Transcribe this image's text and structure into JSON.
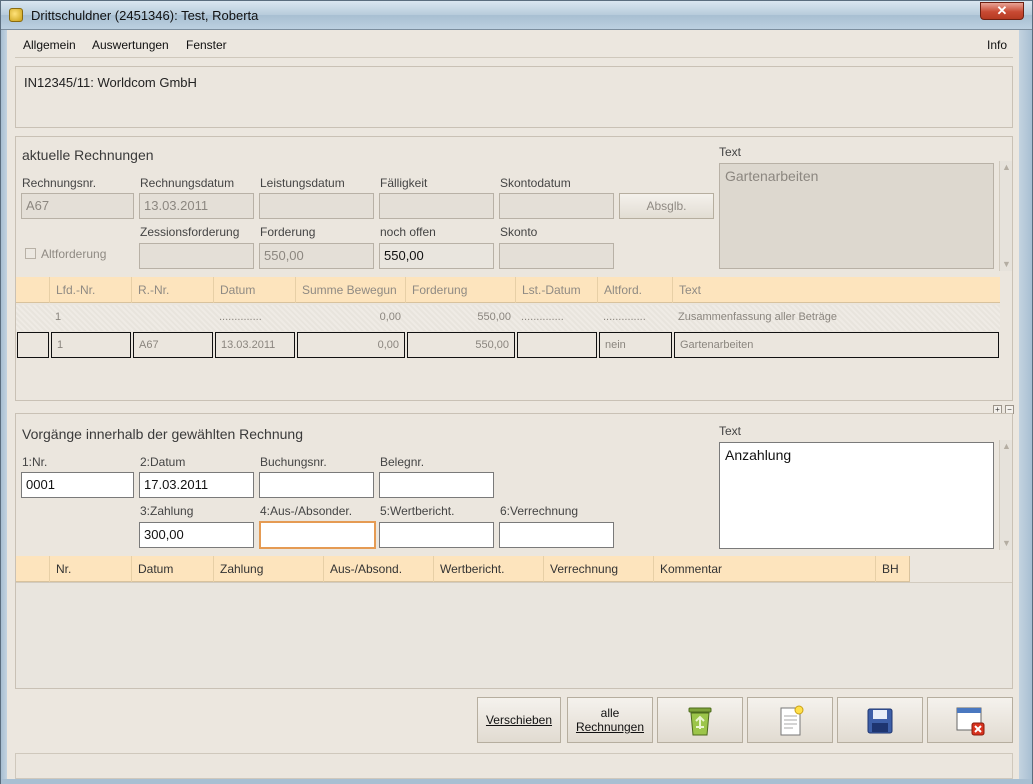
{
  "window": {
    "title": "Drittschuldner (2451346): Test, Roberta",
    "close_label": "✕"
  },
  "menu": {
    "items": [
      "Allgemein",
      "Auswertungen",
      "Fenster"
    ],
    "info": "Info"
  },
  "info_text": "IN12345/11: Worldcom GmbH",
  "rechnungen": {
    "title": "aktuelle Rechnungen",
    "labels": {
      "rechnungsnr": "Rechnungsnr.",
      "rechnungsdatum": "Rechnungsdatum",
      "leistungsdatum": "Leistungsdatum",
      "faelligkeit": "Fälligkeit",
      "skontodatum": "Skontodatum",
      "altforderung": "Altforderung",
      "zessionsforderung": "Zessionsforderung",
      "forderung": "Forderung",
      "noch_offen": "noch offen",
      "skonto": "Skonto",
      "text": "Text"
    },
    "values": {
      "rechnungsnr": "A67",
      "rechnungsdatum": "13.03.2011",
      "leistungsdatum": "",
      "faelligkeit": "",
      "skontodatum": "",
      "zessionsforderung": "",
      "forderung": "550,00",
      "noch_offen": "550,00",
      "skonto": "",
      "text": "Gartenarbeiten"
    },
    "absglb_button": "Absglb.",
    "table": {
      "columns": [
        "",
        "Lfd.-Nr.",
        "R.-Nr.",
        "Datum",
        "Summe Bewegun",
        "Forderung",
        "Lst.-Datum",
        "Altford.",
        "Text"
      ],
      "rows": [
        [
          "",
          "1",
          "",
          "..............",
          "0,00",
          "550,00",
          "..............",
          "..............",
          "Zusammenfassung aller Beträge"
        ],
        [
          "",
          "1",
          "A67",
          "13.03.2011",
          "0,00",
          "550,00",
          "",
          "nein",
          "Gartenarbeiten"
        ]
      ]
    }
  },
  "vorgaenge": {
    "title": "Vorgänge innerhalb der gewählten Rechnung",
    "labels": {
      "nr": "1:Nr.",
      "datum": "2:Datum",
      "buchungsnr": "Buchungsnr.",
      "belegnr": "Belegnr.",
      "zahlung": "3:Zahlung",
      "aus_absonder": "4:Aus-/Absonder.",
      "wertbericht": "5:Wertbericht.",
      "verrechnung": "6:Verrechnung",
      "text": "Text"
    },
    "values": {
      "nr": "0001",
      "datum": "17.03.2011",
      "buchungsnr": "",
      "belegnr": "",
      "zahlung": "300,00",
      "aus_absonder": "",
      "wertbericht": "",
      "verrechnung": "",
      "text": "Anzahlung"
    },
    "table": {
      "columns": [
        "",
        "Nr.",
        "Datum",
        "Zahlung",
        "Aus-/Absond.",
        "Wertbericht.",
        "Verrechnung",
        "Kommentar",
        "BH"
      ],
      "rows": []
    }
  },
  "toolbar": {
    "verschieben": "Verschieben",
    "alle_rechnungen_1": "alle",
    "alle_rechnungen_2": "Rechnungen",
    "recycle_icon": "recycle-bin-icon",
    "new_icon": "new-document-icon",
    "save_icon": "save-disk-icon",
    "close_icon": "close-window-icon"
  },
  "splitter": {
    "plus": "+",
    "minus": "−"
  }
}
